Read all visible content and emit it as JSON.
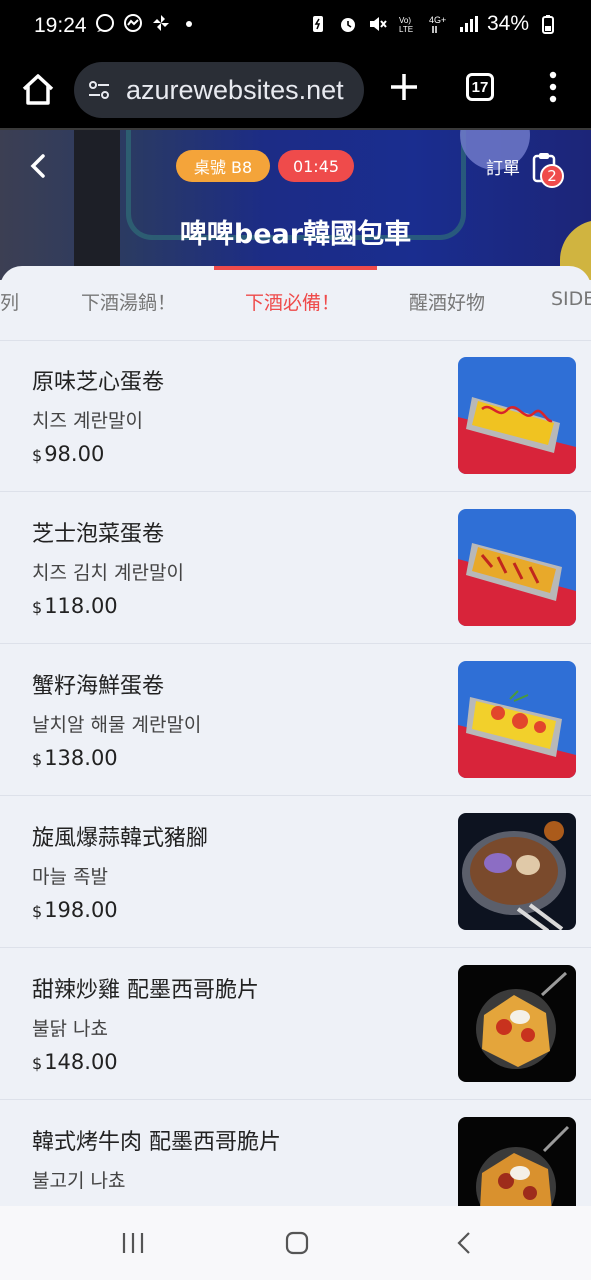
{
  "status_bar": {
    "time": "19:24",
    "battery": "34%",
    "icons": [
      "whatsapp-icon",
      "messenger-icon",
      "pinwheel-icon",
      "dot-icon",
      "battery-saver-icon",
      "alarm-icon",
      "mute-icon",
      "volte-icon",
      "4g-icon",
      "signal-icon",
      "battery-icon"
    ]
  },
  "browser": {
    "url": "azurewebsites.net",
    "tab_count": "17"
  },
  "header": {
    "table_label": "桌號 B8",
    "timer": "01:45",
    "title": "啤啤bear韓國包車",
    "order_label": "訂單",
    "order_count": "2"
  },
  "categories": [
    {
      "label": "列"
    },
    {
      "label": "下酒湯鍋！"
    },
    {
      "label": "下酒必備！",
      "active": true
    },
    {
      "label": "醒酒好物"
    },
    {
      "label": "SIDE"
    }
  ],
  "items": [
    {
      "name": "原味芝心蛋卷",
      "korean": "치즈 계란말이",
      "currency": "$",
      "price": "98.00",
      "image": "omelette-roll-yellow"
    },
    {
      "name": "芝士泡菜蛋卷",
      "korean": "치즈 김치 계란말이",
      "currency": "$",
      "price": "118.00",
      "image": "omelette-roll-kimchi"
    },
    {
      "name": "蟹籽海鮮蛋卷",
      "korean": "날치알 해물 계란말이",
      "currency": "$",
      "price": "138.00",
      "image": "omelette-roll-roe"
    },
    {
      "name": "旋風爆蒜韓式豬腳",
      "korean": "마늘 족발",
      "currency": "$",
      "price": "198.00",
      "image": "garlic-pork-trotters"
    },
    {
      "name": "甜辣炒雞 配墨西哥脆片",
      "korean": "불닭 나쵸",
      "currency": "$",
      "price": "148.00",
      "image": "spicy-chicken-nachos"
    },
    {
      "name": "韓式烤牛肉 配墨西哥脆片",
      "korean": "불고기 나쵸",
      "currency": "",
      "price": "",
      "image": "bulgogi-nachos"
    }
  ],
  "colors": {
    "accent": "#ef4b4b",
    "table_badge": "#f4a43a",
    "banner": "#1a2d8f"
  }
}
